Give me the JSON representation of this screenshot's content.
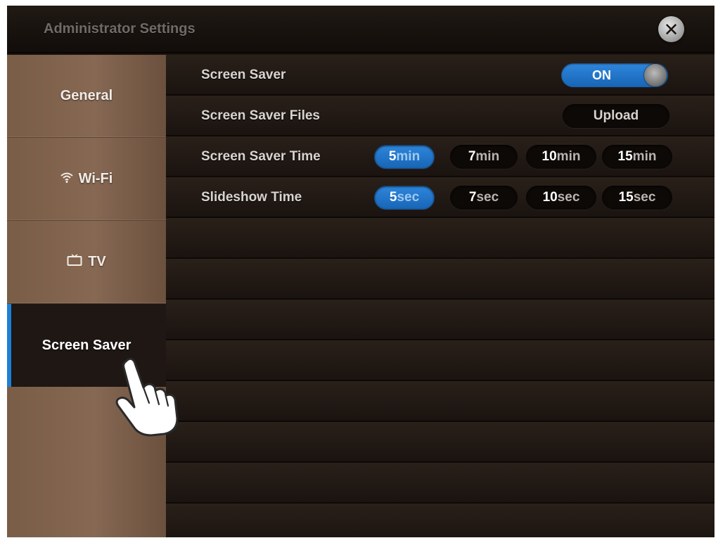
{
  "window": {
    "title": "Administrator Settings",
    "close_icon": "close-icon"
  },
  "sidebar": {
    "items": [
      {
        "label": "General",
        "icon": "",
        "active": false
      },
      {
        "label": "Wi-Fi",
        "icon": "wifi-icon",
        "active": false
      },
      {
        "label": "TV",
        "icon": "tv-icon",
        "active": false
      },
      {
        "label": "Screen Saver",
        "icon": "",
        "active": true
      }
    ]
  },
  "settings": {
    "screen_saver": {
      "label": "Screen Saver",
      "toggle_state": "ON"
    },
    "screen_saver_files": {
      "label": "Screen Saver Files",
      "button": "Upload"
    },
    "screen_saver_time": {
      "label": "Screen Saver Time",
      "options": [
        {
          "num": "5",
          "unit": "min",
          "selected": true
        },
        {
          "num": "7",
          "unit": "min",
          "selected": false
        },
        {
          "num": "10",
          "unit": "min",
          "selected": false
        },
        {
          "num": "15",
          "unit": "min",
          "selected": false
        }
      ]
    },
    "slideshow_time": {
      "label": "Slideshow Time",
      "options": [
        {
          "num": "5",
          "unit": "sec",
          "selected": true
        },
        {
          "num": "7",
          "unit": "sec",
          "selected": false
        },
        {
          "num": "10",
          "unit": "sec",
          "selected": false
        },
        {
          "num": "15",
          "unit": "sec",
          "selected": false
        }
      ]
    }
  },
  "colors": {
    "accent": "#1f7fd6",
    "sidebar": "#866853",
    "background": "#1c140f"
  },
  "cursor_icon": "hand-pointer-icon"
}
